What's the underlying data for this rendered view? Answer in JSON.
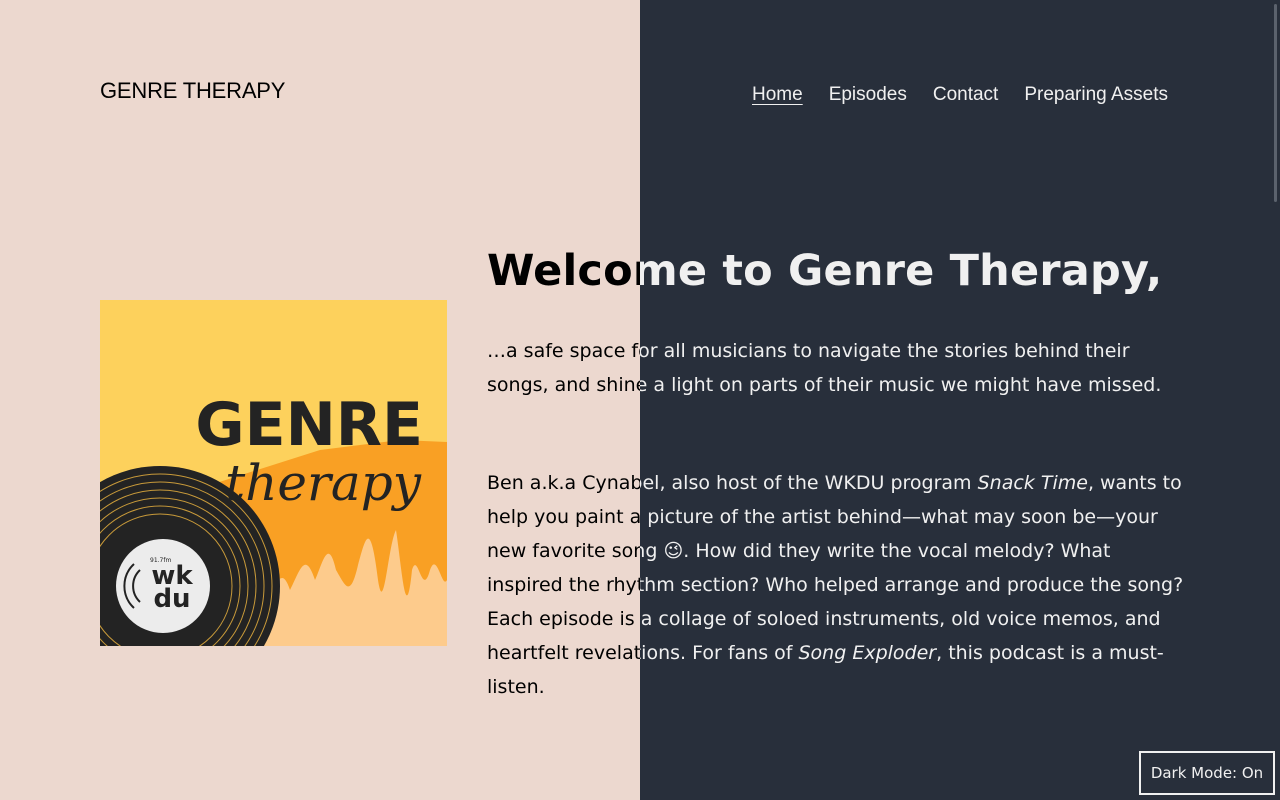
{
  "site": {
    "title": "GENRE THERAPY"
  },
  "nav": {
    "items": [
      {
        "label": "Home",
        "current": true
      },
      {
        "label": "Episodes"
      },
      {
        "label": "Contact"
      },
      {
        "label": "Preparing Assets"
      }
    ]
  },
  "main": {
    "heading": "Welcome to Genre Therapy,",
    "p1": "…a safe space for all musicians to navigate the stories behind their songs, and shine a light on parts of their music we might have missed.",
    "p2": {
      "a": "Ben a.k.a Cynabel, also host of the WKDU program ",
      "b": "Snack Time",
      "c": ", wants to help you paint a picture of the artist behind—what may soon be—your new favorite song ",
      "emoji": "😉",
      "d": ". How did they write the vocal melody? What inspired the rhythm section? Who helped arrange and produce the song? Each episode is a collage of soloed instruments, old voice memos, and heartfelt revelations. For fans of ",
      "e": "Song Exploder",
      "f": ", this podcast is a must-listen."
    }
  },
  "cover": {
    "line1": "GENRE",
    "line2": "therapy",
    "badge_line1": "wk",
    "badge_line2": "du",
    "badge_small": "91.7fm"
  },
  "dark_mode_toggle": {
    "label": "Dark Mode: On"
  },
  "colors": {
    "light_bg": "#ecd8cf",
    "dark_bg": "#282f3b",
    "cover_yellow": "#fdd15c",
    "cover_orange": "#f9a024",
    "cover_peach": "#fdcb8c"
  }
}
